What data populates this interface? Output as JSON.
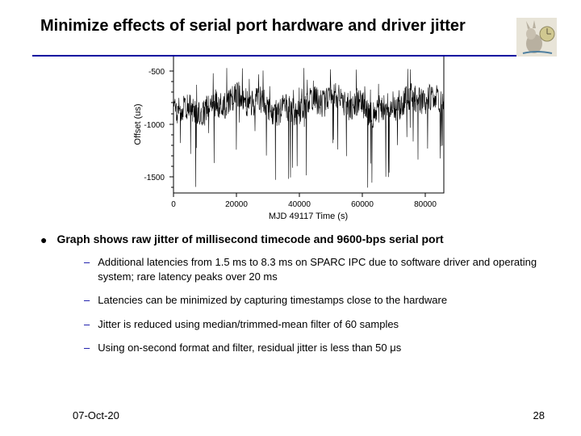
{
  "slide": {
    "title": "Minimize effects of serial port hardware and driver jitter",
    "main_bullet": "Graph shows raw jitter of millisecond timecode and 9600-bps serial port",
    "sub_bullets": [
      "Additional latencies from 1.5 ms to 8.3 ms on SPARC IPC due to software driver and operating system; rare latency peaks over 20 ms",
      "Latencies can be minimized by capturing timestamps close to the hardware",
      "Jitter is reduced using median/trimmed-mean filter of 60 samples",
      "Using on-second format and filter, residual jitter is less than 50 μs"
    ],
    "footer_date": "07-Oct-20",
    "footer_page": "28"
  },
  "chart_data": {
    "type": "line",
    "title": "",
    "xlabel": "MJD 49117 Time (s)",
    "ylabel": "Offset (us)",
    "xlim": [
      0,
      86000
    ],
    "ylim": [
      -1700,
      -400
    ],
    "x_ticks": [
      0,
      20000,
      40000,
      60000,
      80000
    ],
    "y_ticks": [
      -1500,
      -1000,
      -500
    ],
    "series": [
      {
        "name": "offset",
        "note": "dense noisy jitter centered around -800 to -900, spikes down to ~-1700, up to ~-500, full x range 0..86000"
      }
    ]
  }
}
